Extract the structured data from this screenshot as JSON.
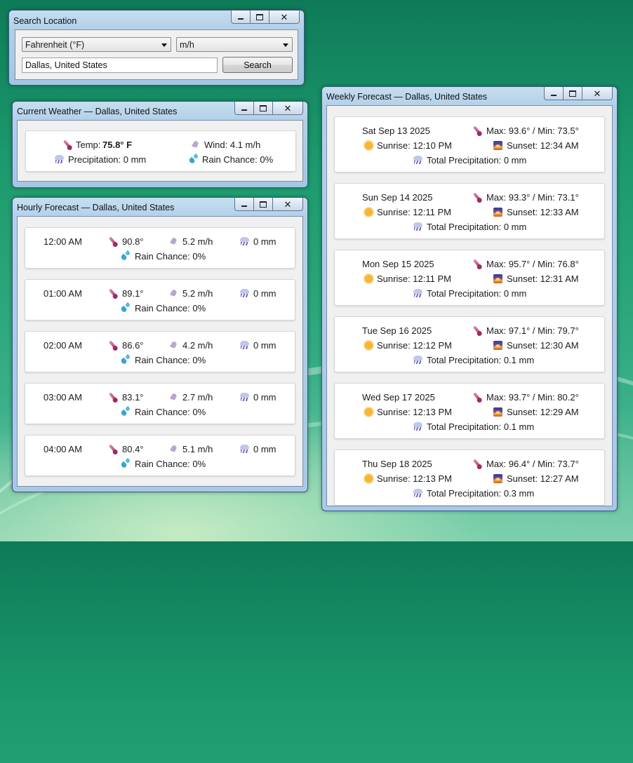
{
  "search_window": {
    "title": "Search Location",
    "unit_temp": "Fahrenheit (°F)",
    "unit_speed": "m/h",
    "location_value": "Dallas, United States",
    "search_label": "Search"
  },
  "current_window": {
    "title": "Current Weather — Dallas, United States",
    "temp_label": "Temp:",
    "temp_value": "75.8° F",
    "wind": "Wind: 4.1 m/h",
    "precipitation": "Precipitation: 0 mm",
    "rain_chance": "Rain Chance: 0%"
  },
  "hourly_window": {
    "title": "Hourly Forecast — Dallas, United States",
    "rows": [
      {
        "time": "12:00 AM",
        "temp": "90.8°",
        "wind": "5.2 m/h",
        "precip": "0 mm",
        "rain": "Rain Chance: 0%"
      },
      {
        "time": "01:00 AM",
        "temp": "89.1°",
        "wind": "5.2 m/h",
        "precip": "0 mm",
        "rain": "Rain Chance: 0%"
      },
      {
        "time": "02:00 AM",
        "temp": "86.6°",
        "wind": "4.2 m/h",
        "precip": "0 mm",
        "rain": "Rain Chance: 0%"
      },
      {
        "time": "03:00 AM",
        "temp": "83.1°",
        "wind": "2.7 m/h",
        "precip": "0 mm",
        "rain": "Rain Chance: 0%"
      },
      {
        "time": "04:00 AM",
        "temp": "80.4°",
        "wind": "5.1 m/h",
        "precip": "0 mm",
        "rain": "Rain Chance: 0%"
      }
    ]
  },
  "weekly_window": {
    "title": "Weekly Forecast — Dallas, United States",
    "days": [
      {
        "date": "Sat Sep 13 2025",
        "maxmin": "Max: 93.6° / Min: 73.5°",
        "sunrise": "Sunrise: 12:10 PM",
        "sunset": "Sunset: 12:34 AM",
        "precip": "Total Precipitation: 0 mm"
      },
      {
        "date": "Sun Sep 14 2025",
        "maxmin": "Max: 93.3° / Min: 73.1°",
        "sunrise": "Sunrise: 12:11 PM",
        "sunset": "Sunset: 12:33 AM",
        "precip": "Total Precipitation: 0 mm"
      },
      {
        "date": "Mon Sep 15 2025",
        "maxmin": "Max: 95.7° / Min: 76.8°",
        "sunrise": "Sunrise: 12:11 PM",
        "sunset": "Sunset: 12:31 AM",
        "precip": "Total Precipitation: 0 mm"
      },
      {
        "date": "Tue Sep 16 2025",
        "maxmin": "Max: 97.1° / Min: 79.7°",
        "sunrise": "Sunrise: 12:12 PM",
        "sunset": "Sunset: 12:30 AM",
        "precip": "Total Precipitation: 0.1 mm"
      },
      {
        "date": "Wed Sep 17 2025",
        "maxmin": "Max: 93.7° / Min: 80.2°",
        "sunrise": "Sunrise: 12:13 PM",
        "sunset": "Sunset: 12:29 AM",
        "precip": "Total Precipitation: 0.1 mm"
      },
      {
        "date": "Thu Sep 18 2025",
        "maxmin": "Max: 96.4° / Min: 73.7°",
        "sunrise": "Sunrise: 12:13 PM",
        "sunset": "Sunset: 12:27 AM",
        "precip": "Total Precipitation: 0.3 mm"
      }
    ]
  },
  "icons": {
    "temperature": "thermometer-icon",
    "wind": "wind-icon",
    "precipitation": "rain-cloud-icon",
    "rain_chance": "droplets-icon",
    "sunrise": "sun-icon",
    "sunset": "sunset-icon"
  }
}
